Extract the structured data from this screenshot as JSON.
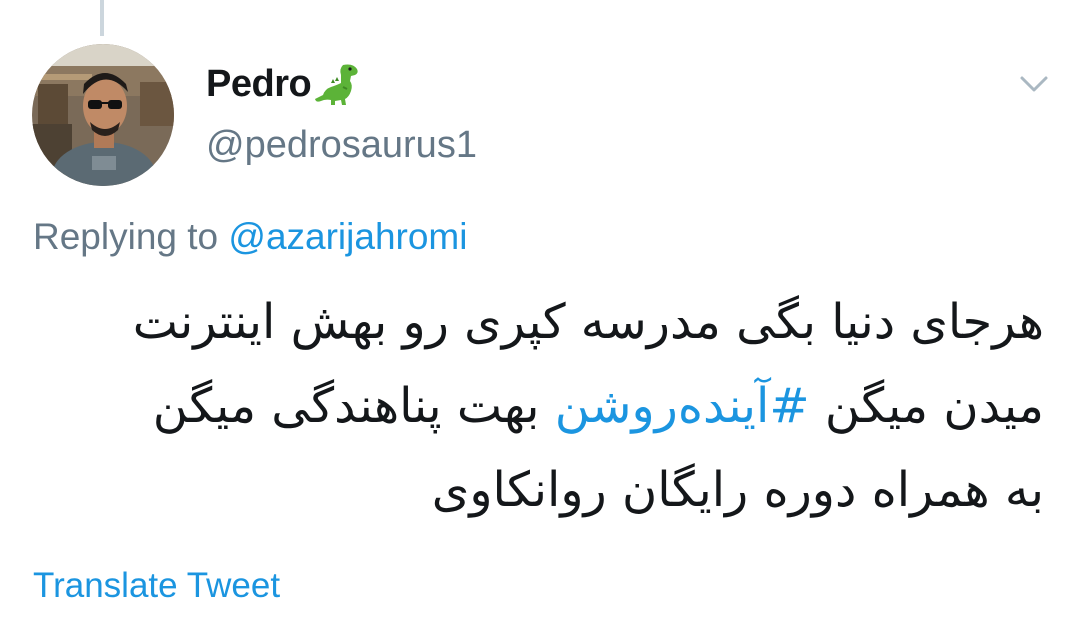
{
  "author": {
    "display_name": "Pedro",
    "name_emoji": "dinosaur-icon",
    "handle": "@pedrosaurus1",
    "avatar": "avatar-photo"
  },
  "reply": {
    "prefix": "Replying to ",
    "to_handle": "@azarijahromi"
  },
  "tweet": {
    "line1": "هرجای دنیا بگی مدرسه کپری رو بهش اینترنت",
    "line2_before": "میدن میگن ",
    "hashtag": "#آینده‌روشن",
    "line2_after": " بهت پناهندگی میگن",
    "line3": "به همراه دوره رایگان روانکاوی"
  },
  "actions": {
    "translate_label": "Translate Tweet",
    "menu_icon": "chevron-down-icon"
  },
  "colors": {
    "link": "#1b95e0",
    "text": "#14171a",
    "secondary": "#657786"
  }
}
